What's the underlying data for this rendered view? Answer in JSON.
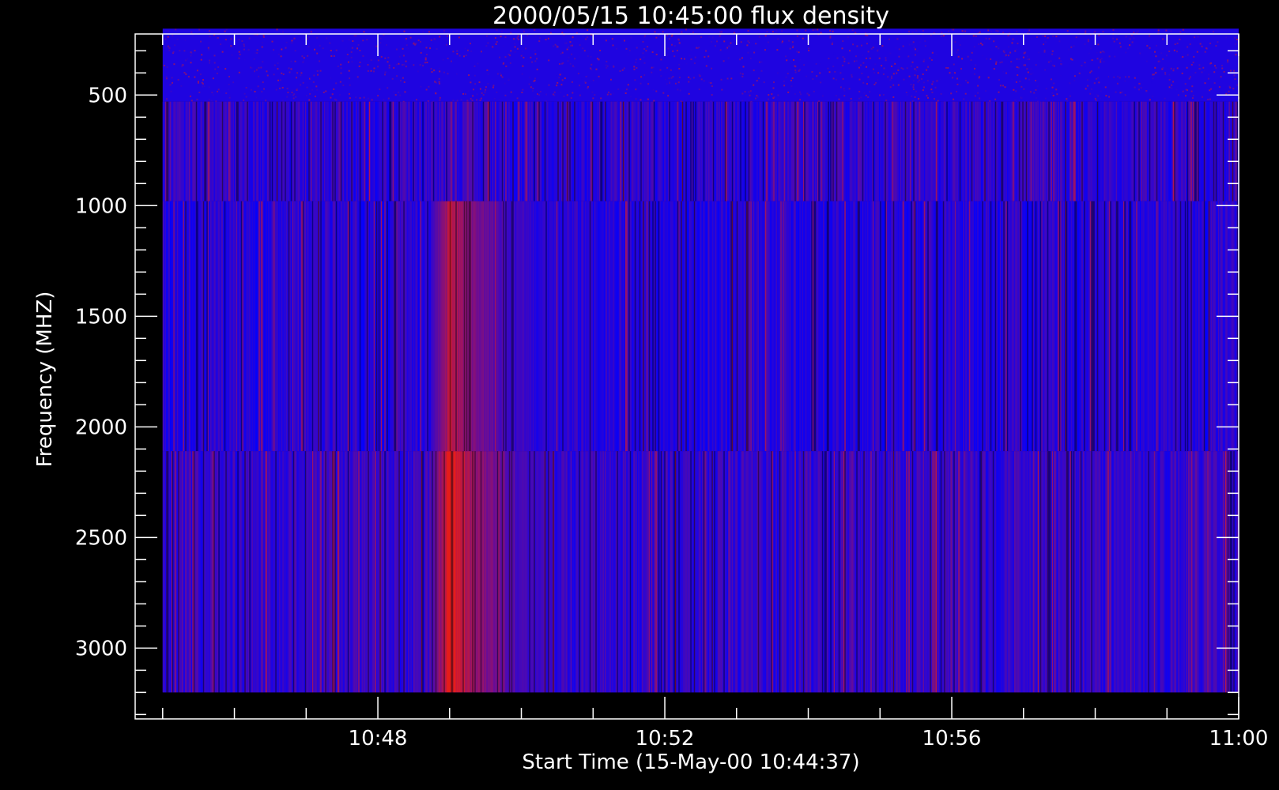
{
  "chart_data": {
    "type": "heatmap",
    "title": "2000/05/15 10:45:00 flux density",
    "xlabel": "Start Time (15-May-00 10:44:37)",
    "ylabel": "Frequency (MHZ)",
    "x_range": [
      "10:44:37",
      "11:00:00"
    ],
    "y_range_mhz": [
      3320,
      224
    ],
    "y_reversed": true,
    "x_ticks": [
      "10:48",
      "10:52",
      "10:56",
      "11:00"
    ],
    "y_ticks": [
      500,
      1000,
      1500,
      2000,
      2500,
      3000
    ],
    "data_x_range": [
      "10:45:00",
      "11:00:00"
    ],
    "data_y_range_mhz": [
      200,
      3200
    ],
    "bands": [
      {
        "freq_mhz": [
          200,
          530
        ],
        "texture": "speckle",
        "base_level": 0.12
      },
      {
        "freq_mhz": [
          530,
          980
        ],
        "texture": "stripes",
        "base_level": 0.18
      },
      {
        "freq_mhz": [
          980,
          2110
        ],
        "texture": "stripes",
        "base_level": 0.15
      },
      {
        "freq_mhz": [
          2110,
          3200
        ],
        "texture": "stripes",
        "base_level": 0.2
      }
    ],
    "burst": {
      "start": "10:48:40",
      "peak": "10:49:00",
      "end": "10:51:00",
      "freq_mhz": [
        980,
        3200
      ],
      "peak_level": 0.95
    },
    "colormap": {
      "low": "#0000ff",
      "high": "#ff2000"
    },
    "grid": false,
    "background_color": "#000000",
    "axis_color": "#ffffff"
  }
}
